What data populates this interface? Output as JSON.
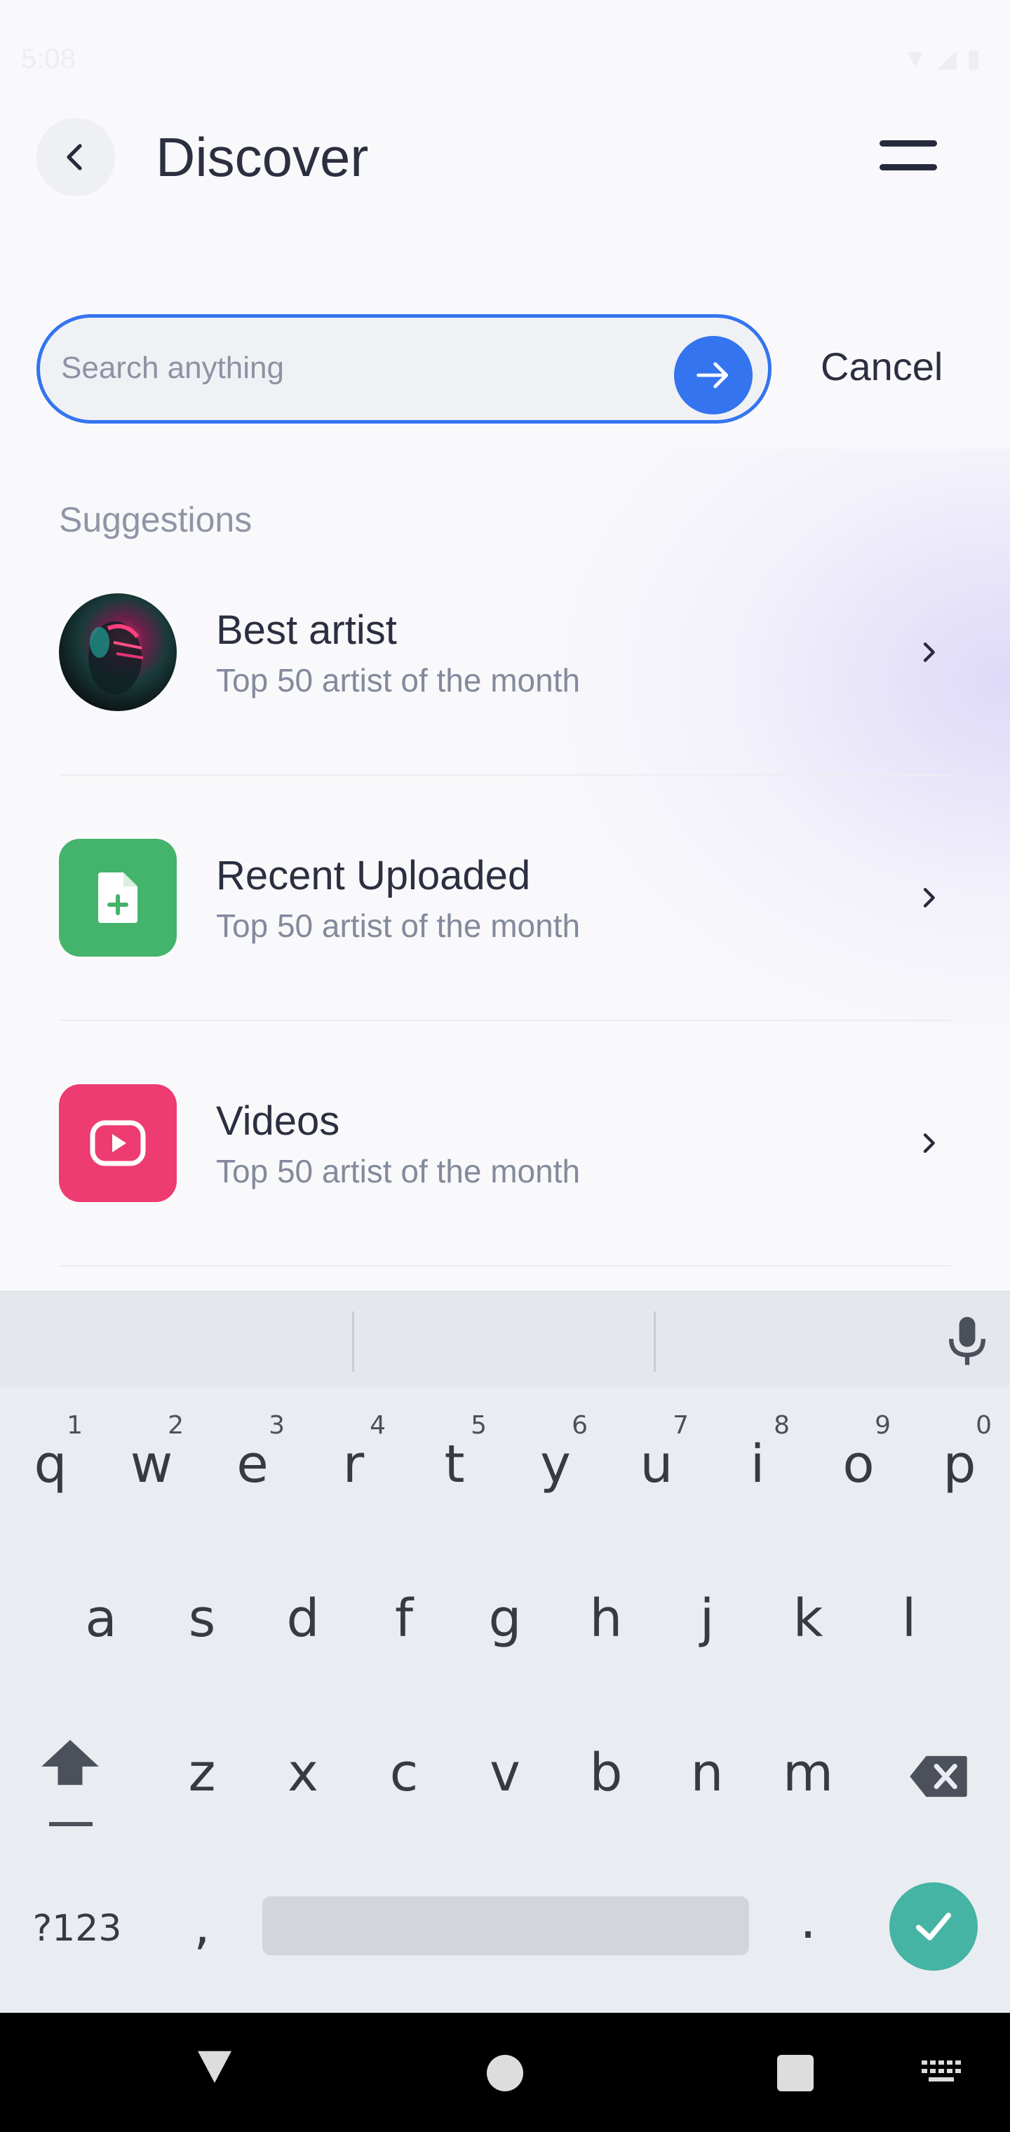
{
  "status_bar": {
    "time": "5:08"
  },
  "header": {
    "title": "Discover"
  },
  "search": {
    "placeholder": "Search anything",
    "value": "",
    "cancel_label": "Cancel"
  },
  "suggestions": {
    "heading": "Suggestions",
    "items": [
      {
        "title": "Best artist",
        "subtitle": "Top 50 artist of the month",
        "icon": "artist-avatar"
      },
      {
        "title": "Recent Uploaded",
        "subtitle": "Top 50 artist of the month",
        "icon": "file-add-icon"
      },
      {
        "title": "Videos",
        "subtitle": "Top 50 artist of the month",
        "icon": "play-video-icon"
      }
    ]
  },
  "keyboard": {
    "row1": [
      "q",
      "w",
      "e",
      "r",
      "t",
      "y",
      "u",
      "i",
      "o",
      "p"
    ],
    "row1_hints": [
      "1",
      "2",
      "3",
      "4",
      "5",
      "6",
      "7",
      "8",
      "9",
      "0"
    ],
    "row2": [
      "a",
      "s",
      "d",
      "f",
      "g",
      "h",
      "j",
      "k",
      "l"
    ],
    "row3": [
      "z",
      "x",
      "c",
      "v",
      "b",
      "n",
      "m"
    ],
    "symbols_label": "?123",
    "comma": ",",
    "period": "."
  },
  "colors": {
    "accent": "#3474ef",
    "green": "#44b36b",
    "pink": "#ee3c72",
    "keyboard_enter": "#45b4a4",
    "title": "#2c2f40"
  }
}
